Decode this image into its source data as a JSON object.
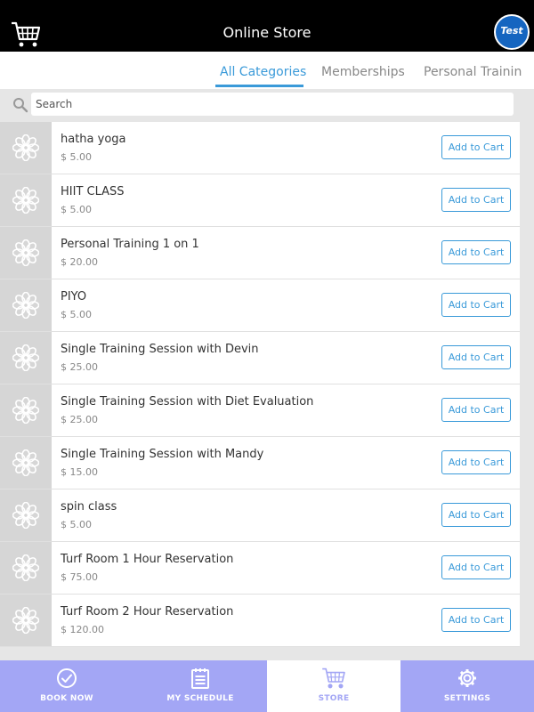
{
  "header": {
    "title": "Online Store",
    "avatar_text": "Test"
  },
  "tabs": [
    {
      "label": "All Categories",
      "active": true
    },
    {
      "label": "Memberships",
      "active": false
    },
    {
      "label": "Personal Trainin",
      "active": false
    }
  ],
  "search": {
    "placeholder": "Search",
    "value": ""
  },
  "products": [
    {
      "name": "hatha yoga",
      "price": "$ 5.00",
      "button": "Add to Cart"
    },
    {
      "name": "HIIT CLASS",
      "price": "$ 5.00",
      "button": "Add to Cart"
    },
    {
      "name": "Personal Training 1 on 1",
      "price": "$ 20.00",
      "button": "Add to Cart"
    },
    {
      "name": "PIYO",
      "price": "$ 5.00",
      "button": "Add to Cart"
    },
    {
      "name": "Single Training Session with Devin",
      "price": "$ 25.00",
      "button": "Add to Cart"
    },
    {
      "name": "Single Training Session with Diet Evaluation",
      "price": "$ 25.00",
      "button": "Add to Cart"
    },
    {
      "name": "Single Training Session with Mandy",
      "price": "$ 15.00",
      "button": "Add to Cart"
    },
    {
      "name": "spin class",
      "price": "$ 5.00",
      "button": "Add to Cart"
    },
    {
      "name": "Turf Room 1 Hour Reservation",
      "price": "$ 75.00",
      "button": "Add to Cart"
    },
    {
      "name": "Turf Room 2 Hour Reservation",
      "price": "$ 120.00",
      "button": "Add to Cart"
    }
  ],
  "bottom_nav": [
    {
      "label": "BOOK NOW",
      "icon": "check-circle-icon",
      "active": false
    },
    {
      "label": "MY SCHEDULE",
      "icon": "calendar-icon",
      "active": false
    },
    {
      "label": "STORE",
      "icon": "cart-icon",
      "active": true
    },
    {
      "label": "SETTINGS",
      "icon": "gear-icon",
      "active": false
    }
  ],
  "colors": {
    "accent": "#3a9ad9",
    "nav_bg": "#a3a6f5",
    "header_bg": "#000000",
    "avatar_bg": "#1565c0"
  }
}
